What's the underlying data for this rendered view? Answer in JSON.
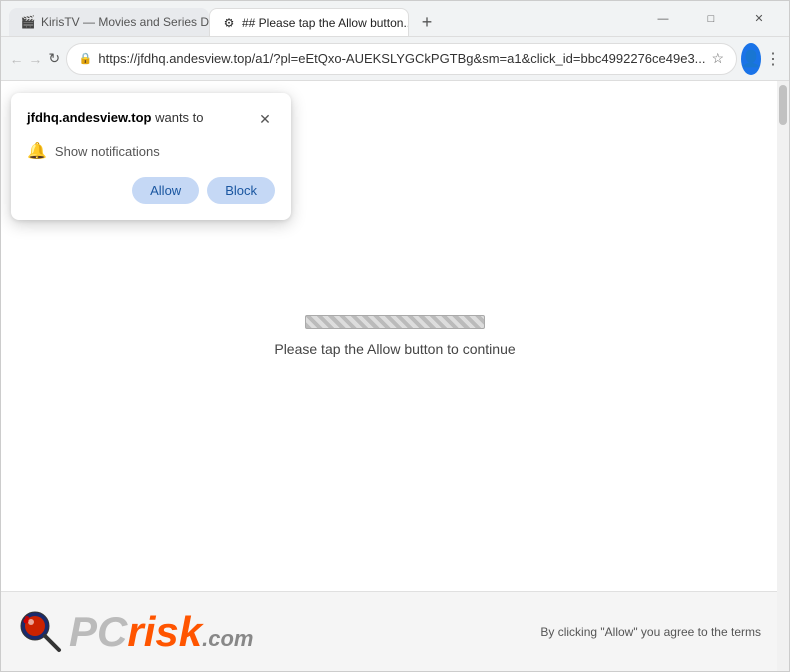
{
  "browser": {
    "tabs": [
      {
        "id": "tab1",
        "label": "KirisTV — Movies and Series D...",
        "active": false,
        "favicon": "🎬"
      },
      {
        "id": "tab2",
        "label": "## Please tap the Allow button...",
        "active": true,
        "favicon": "⚙"
      }
    ],
    "new_tab_label": "+",
    "window_controls": {
      "minimize": "—",
      "maximize": "□",
      "close": "✕"
    },
    "nav": {
      "back": "←",
      "forward": "→",
      "refresh": "↻",
      "address": "https://jfdhq.andesview.top/a1/?pl=eEtQxo-AUEKSLYGCkPGTBg&sm=a1&click_id=bbc4992276ce49e3...",
      "address_short": "https://jfdhq.andesview.top/a1/?pl=eEtQxo-AUEKSLYGCkPGTBg&sm=a1&click_id=bbc4992276ce49e3...",
      "star": "☆",
      "profile_initial": "👤",
      "menu": "⋮"
    }
  },
  "popup": {
    "site": "jfdhq.andesview.top",
    "wants_to": " wants to",
    "close_icon": "✕",
    "permission_label": "Show notifications",
    "allow_label": "Allow",
    "block_label": "Block"
  },
  "page": {
    "progress_text": "Please tap the Allow button to continue"
  },
  "watermark": {
    "pc_text": "PC",
    "risk_text": "risk",
    "dotcom_text": ".com",
    "caption": "By clicking \"Allow\" you agree to the terms"
  }
}
